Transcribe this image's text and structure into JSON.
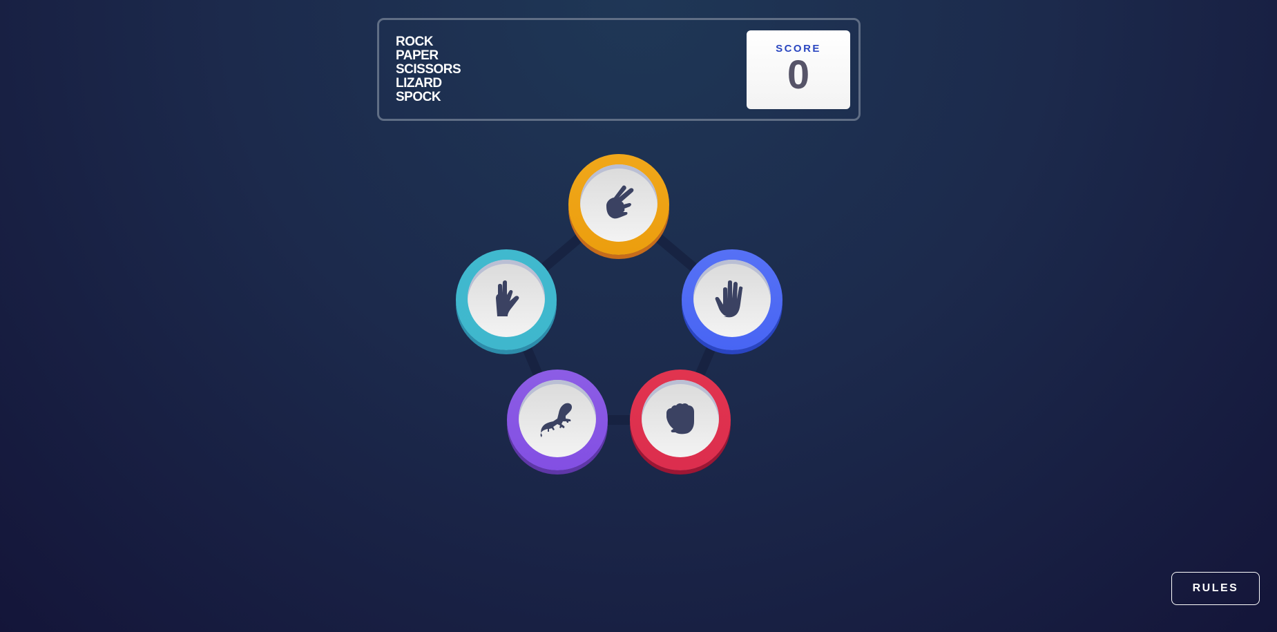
{
  "header": {
    "title_lines": [
      "ROCK",
      "PAPER",
      "SCISSORS",
      "LIZARD",
      "SPOCK"
    ],
    "score": {
      "label": "SCORE",
      "value": "0"
    }
  },
  "tokens": [
    {
      "id": "scissors",
      "icon": "scissors-hand-icon",
      "color": "#ec9e0e"
    },
    {
      "id": "spock",
      "icon": "spock-hand-icon",
      "color": "#3fb7cd"
    },
    {
      "id": "paper",
      "icon": "paper-hand-icon",
      "color": "#4865f4"
    },
    {
      "id": "lizard",
      "icon": "lizard-icon",
      "color": "#834fe3"
    },
    {
      "id": "rock",
      "icon": "rock-fist-icon",
      "color": "#dc2e4e"
    }
  ],
  "rules_button": {
    "label": "RULES"
  },
  "colors": {
    "background": "#1c2a4c",
    "icon": "#3b4262",
    "score_label": "#2a46c0"
  }
}
